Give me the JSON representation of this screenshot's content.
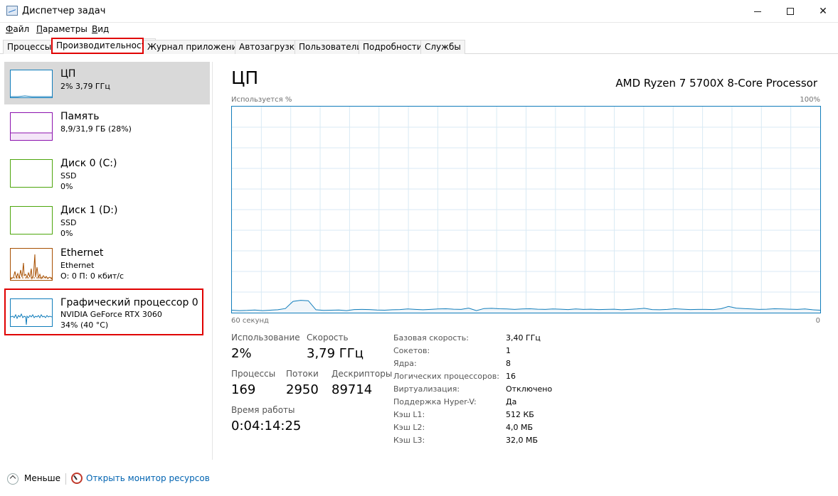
{
  "window": {
    "title": "Диспетчер задач"
  },
  "menu": [
    {
      "label": "Файл",
      "ul": "Ф",
      "rest": "айл"
    },
    {
      "label": "Параметры",
      "ul": "П",
      "rest": "араметры"
    },
    {
      "label": "Вид",
      "ul": "В",
      "rest": "ид"
    }
  ],
  "tabs": [
    "Процессы",
    "Производительность",
    "Журнал приложений",
    "Автозагрузка",
    "Пользователи",
    "Подробности",
    "Службы"
  ],
  "active_tab": "Производительность",
  "sidebar": [
    {
      "title": "ЦП",
      "line1": "2% 3,79 ГГц",
      "line2": "",
      "color": "#117dbb"
    },
    {
      "title": "Память",
      "line1": "8,9/31,9 ГБ (28%)",
      "line2": "",
      "color": "#8b12ae"
    },
    {
      "title": "Диск 0 (C:)",
      "line1": "SSD",
      "line2": "0%",
      "color": "#4da60c"
    },
    {
      "title": "Диск 1 (D:)",
      "line1": "SSD",
      "line2": "0%",
      "color": "#4da60c"
    },
    {
      "title": "Ethernet",
      "line1": "Ethernet",
      "line2": "О: 0 П: 0 кбит/с",
      "color": "#a74f01"
    },
    {
      "title": "Графический процессор 0",
      "line1": "NVIDIA GeForce RTX 3060",
      "line2": "34% (40 °C)",
      "color": "#117dbb"
    }
  ],
  "main": {
    "title": "ЦП",
    "cpu_name": "AMD Ryzen 7 5700X 8-Core Processor",
    "graph_label": "Используется %",
    "graph_max": "100%",
    "time_label": "60 секунд",
    "time_end": "0",
    "usage_series": [
      1.2,
      1.0,
      1.1,
      1.3,
      1.0,
      1.2,
      1.4,
      2.0,
      5.5,
      6.0,
      5.8,
      1.4,
      1.1,
      1.2,
      1.3,
      1.0,
      1.5,
      1.6,
      1.5,
      1.3,
      1.2,
      1.4,
      1.5,
      1.8,
      1.6,
      1.4,
      1.6,
      1.8,
      1.9,
      1.7,
      1.6,
      2.2,
      1.0,
      2.0,
      2.1,
      1.9,
      1.8,
      1.6,
      1.8,
      1.9,
      1.7,
      1.6,
      1.8,
      1.7,
      1.5,
      1.8,
      1.6,
      1.7,
      1.5,
      1.6,
      1.7,
      1.4,
      1.6,
      1.8,
      2.1,
      1.5,
      1.4,
      1.6,
      1.9,
      1.7,
      1.5,
      1.6,
      1.6,
      1.5,
      1.9,
      3.0,
      2.2,
      2.0,
      1.8,
      1.6,
      1.7,
      1.9,
      1.8,
      1.7,
      1.6,
      1.8,
      1.4,
      1.2
    ],
    "stats": {
      "usage_label": "Использование",
      "usage_value": "2%",
      "speed_label": "Скорость",
      "speed_value": "3,79 ГГц",
      "processes_label": "Процессы",
      "processes_value": "169",
      "threads_label": "Потоки",
      "threads_value": "2950",
      "handles_label": "Дескрипторы",
      "handles_value": "89714",
      "uptime_label": "Время работы",
      "uptime_value": "0:04:14:25"
    },
    "specs": [
      {
        "label": "Базовая скорость:",
        "value": "3,40 ГГц"
      },
      {
        "label": "Сокетов:",
        "value": "1"
      },
      {
        "label": "Ядра:",
        "value": "8"
      },
      {
        "label": "Логических процессоров:",
        "value": "16"
      },
      {
        "label": "Виртуализация:",
        "value": "Отключено"
      },
      {
        "label": "Поддержка Hyper-V:",
        "value": "Да"
      },
      {
        "label": "Кэш L1:",
        "value": "512 КБ"
      },
      {
        "label": "Кэш L2:",
        "value": "4,0 МБ"
      },
      {
        "label": "Кэш L3:",
        "value": "32,0 МБ"
      }
    ]
  },
  "footer": {
    "less": "Меньше",
    "monitor": "Открыть монитор ресурсов"
  },
  "colors": {
    "cpu": "#117dbb",
    "memory": "#8b12ae",
    "disk": "#4da60c",
    "ethernet": "#a74f01",
    "highlight": "#e00000"
  }
}
